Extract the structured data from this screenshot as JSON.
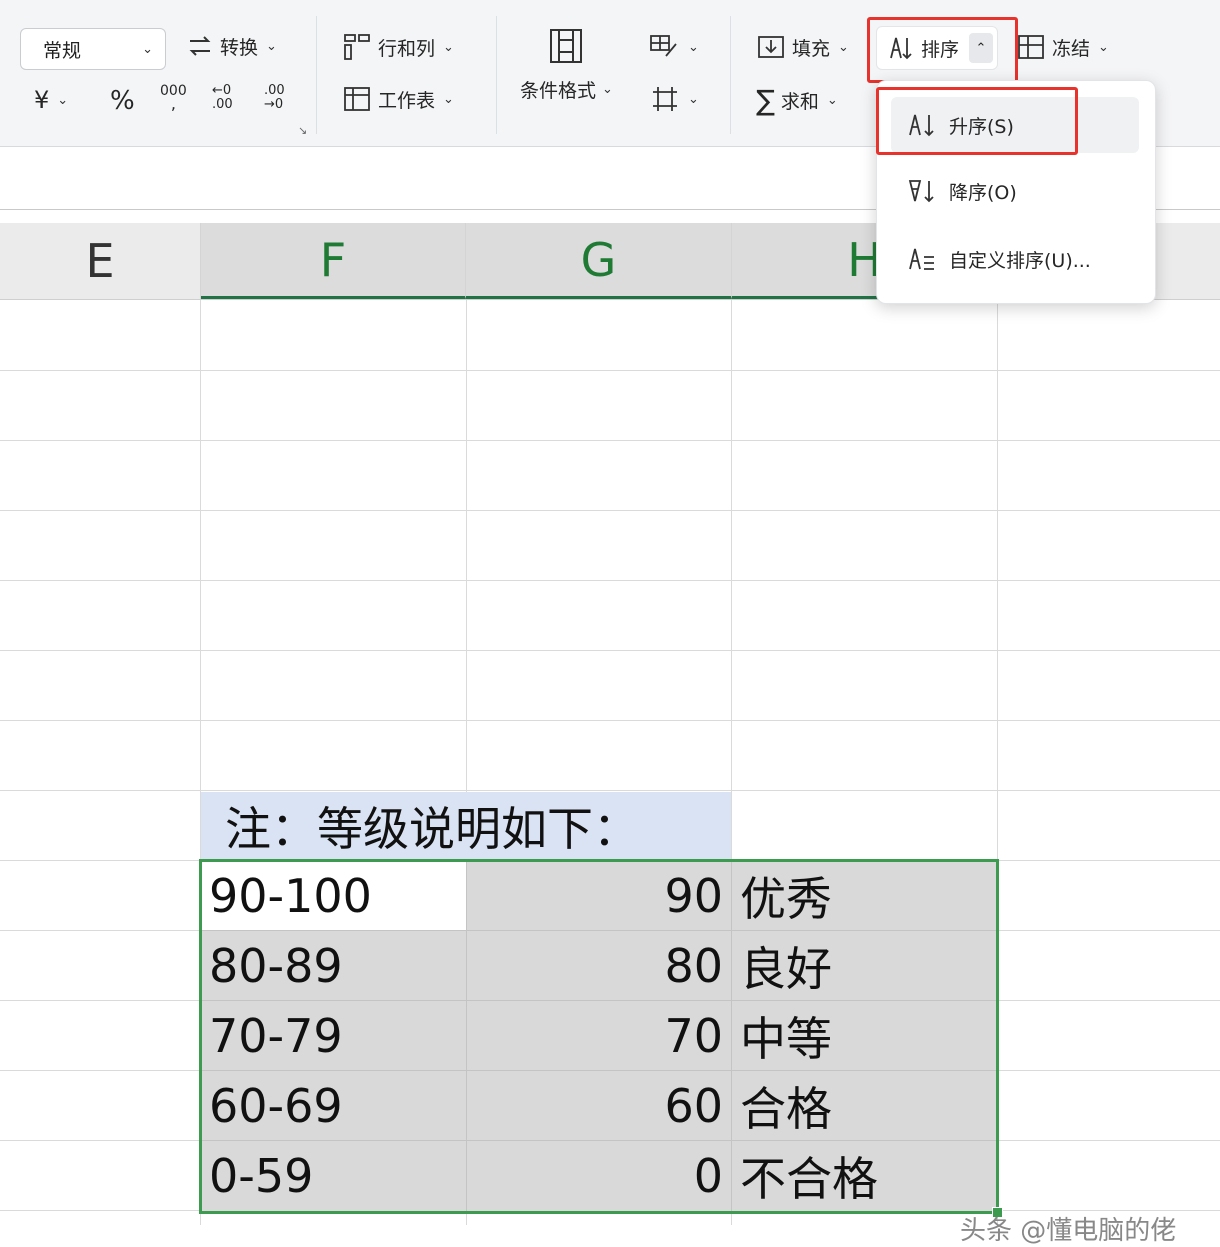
{
  "ribbon": {
    "number_format": "常规",
    "convert_label": "转换",
    "currency_symbol": "¥",
    "percent_symbol": "%",
    "thousands_symbol": "000",
    "dec_inc": "←0 .00",
    "dec_dec": ".00 →0",
    "rows_cols_label": "行和列",
    "worksheet_label": "工作表",
    "cond_format_label": "条件格式",
    "fill_label": "填充",
    "sum_label": "求和",
    "sort_label": "排序",
    "freeze_label": "冻结"
  },
  "sort_menu": {
    "items": [
      {
        "label": "升序(S)",
        "icon": "sort-ascending-icon"
      },
      {
        "label": "降序(O)",
        "icon": "sort-descending-icon"
      },
      {
        "label": "自定义排序(U)...",
        "icon": "custom-sort-icon"
      }
    ]
  },
  "columns": [
    "E",
    "F",
    "G",
    "H"
  ],
  "note": "注：等级说明如下：",
  "table": {
    "rows": [
      {
        "range": "90-100",
        "score": "90",
        "grade": "优秀"
      },
      {
        "range": "80-89",
        "score": "80",
        "grade": "良好"
      },
      {
        "range": "70-79",
        "score": "70",
        "grade": "中等"
      },
      {
        "range": "60-69",
        "score": "60",
        "grade": "合格"
      },
      {
        "range": "0-59",
        "score": "0",
        "grade": "不合格"
      }
    ]
  },
  "watermark": "头条 @懂电脑的佬",
  "colors": {
    "highlight_red": "#e8322c",
    "selection_green": "#3c9b4f",
    "note_fill": "#dae3f3",
    "cell_fill": "#d9d9d9"
  }
}
